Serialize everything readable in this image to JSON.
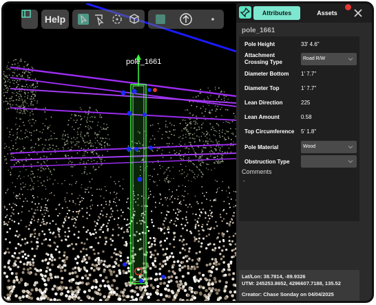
{
  "toolbar": {
    "help_label": "Help",
    "icons": [
      "panel-icon",
      "select-icon",
      "lasso-icon",
      "rotate-icon",
      "cube-icon",
      "move-icon",
      "up-arrow-icon",
      "dot-icon"
    ]
  },
  "viewer": {
    "pole_label": "pole_1661"
  },
  "panel": {
    "tabs": {
      "attributes": "Attributes",
      "assets": "Assets"
    },
    "pole_name": "pole_1661",
    "fields": {
      "pole_height": {
        "label": "Pole Height",
        "value": "33' 4.6\""
      },
      "attachment_crossing_type": {
        "label": "Attachment Crossing Type",
        "value": "Road R/W"
      },
      "diameter_bottom": {
        "label": "Diameter Bottom",
        "value": "1' 7.7\""
      },
      "diameter_top": {
        "label": "Diameter Top",
        "value": "1' 7.7\""
      },
      "lean_direction": {
        "label": "Lean Direction",
        "value": "225"
      },
      "lean_amount": {
        "label": "Lean Amount",
        "value": "0.58"
      },
      "top_circumference": {
        "label": "Top Circumference",
        "value": "5' 1.8\""
      },
      "pole_material": {
        "label": "Pole Material",
        "value": "Wood"
      },
      "obstruction_type": {
        "label": "Obstruction Type",
        "value": ""
      }
    },
    "comments_label": "Comments",
    "comments_value": "-",
    "footer": {
      "latlon": "Lat/Lon: 38.7814, -89.9326",
      "utm": "UTM: 245253.8652, 4296607.7188, 135.52",
      "creator": "Creator: Chase Sonday on 04/04/2025"
    }
  },
  "colors": {
    "accent_tab": "#7de8cf",
    "pin": "#5fe3c3",
    "badge": "#e53935",
    "wire_purple": "#9b2cf0",
    "wire_blue": "#1a1aff",
    "pole_outline": "#3cff3c"
  }
}
